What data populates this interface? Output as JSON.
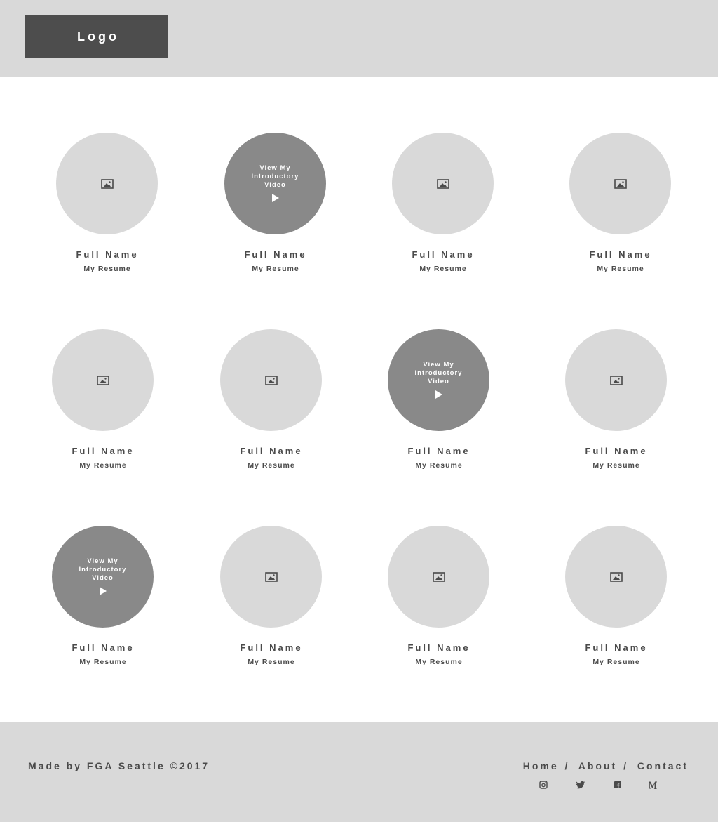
{
  "header": {
    "logo_label": "Logo"
  },
  "cards": [
    {
      "name": "Full Name",
      "link": "My Resume",
      "video": false
    },
    {
      "name": "Full Name",
      "link": "My Resume",
      "video": true
    },
    {
      "name": "Full Name",
      "link": "My Resume",
      "video": false
    },
    {
      "name": "Full Name",
      "link": "My Resume",
      "video": false
    },
    {
      "name": "Full Name",
      "link": "My Resume",
      "video": false
    },
    {
      "name": "Full Name",
      "link": "My Resume",
      "video": false
    },
    {
      "name": "Full Name",
      "link": "My Resume",
      "video": true
    },
    {
      "name": "Full Name",
      "link": "My Resume",
      "video": false
    },
    {
      "name": "Full Name",
      "link": "My Resume",
      "video": true
    },
    {
      "name": "Full Name",
      "link": "My Resume",
      "video": false
    },
    {
      "name": "Full Name",
      "link": "My Resume",
      "video": false
    },
    {
      "name": "Full Name",
      "link": "My Resume",
      "video": false
    }
  ],
  "video_overlay": {
    "line1": "View My",
    "line2": "Introductory",
    "line3": "Video"
  },
  "footer": {
    "credit": "Made by FGA Seattle ©2017",
    "nav": [
      "Home",
      "About",
      "Contact"
    ],
    "separator": "/",
    "social_icons": [
      "instagram-icon",
      "twitter-icon",
      "facebook-icon",
      "medium-icon"
    ]
  },
  "colors": {
    "header_bg": "#d9d9d9",
    "logo_bg": "#4d4d4d",
    "placeholder_circle": "#d9d9d9",
    "video_circle": "#898989",
    "text": "#4a4a4a"
  }
}
